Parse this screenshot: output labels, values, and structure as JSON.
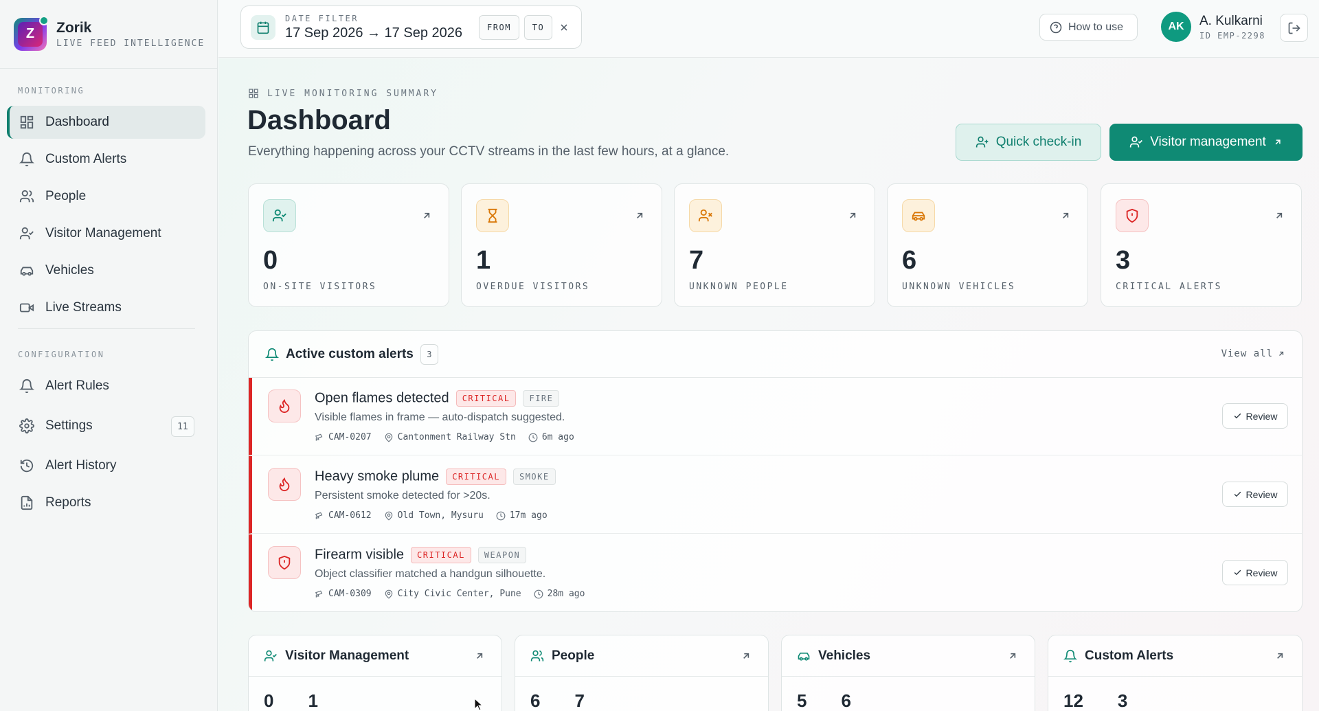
{
  "brand": {
    "name": "Zorik",
    "subtitle": "LIVE FEED INTELLIGENCE",
    "logo_letter": "Z"
  },
  "sidebar": {
    "sections": [
      {
        "label": "MONITORING"
      },
      {
        "label": "CONFIGURATION"
      }
    ],
    "items": [
      {
        "label": "Dashboard",
        "icon": "grid-icon",
        "active": true
      },
      {
        "label": "Custom Alerts",
        "icon": "bell-icon"
      },
      {
        "label": "People",
        "icon": "users-icon"
      },
      {
        "label": "Visitor Management",
        "icon": "user-check-icon"
      },
      {
        "label": "Vehicles",
        "icon": "car-icon"
      },
      {
        "label": "Live Streams",
        "icon": "video-icon"
      },
      {
        "label": "Alert Rules",
        "icon": "bell-icon"
      },
      {
        "label": "Settings",
        "icon": "gear-icon",
        "badge": "11"
      },
      {
        "label": "Alert History",
        "icon": "history-icon"
      },
      {
        "label": "Reports",
        "icon": "report-icon"
      }
    ]
  },
  "header": {
    "date_filter": {
      "label": "DATE FILTER",
      "value": "17 Sep 2026 → 17 Sep 2026",
      "from": "FROM",
      "to": "TO"
    },
    "how_to": "How to use",
    "user": {
      "initials": "AK",
      "name": "A. Kulkarni",
      "id": "ID EMP-2298"
    }
  },
  "page": {
    "kicker": "LIVE MONITORING SUMMARY",
    "title": "Dashboard",
    "subtitle": "Everything happening across your CCTV streams in the last few hours, at a glance.",
    "quick_checkin": "Quick check-in",
    "visitor_mgmt": "Visitor management"
  },
  "stats": [
    {
      "value": "0",
      "label": "ON-SITE VISITORS",
      "icon": "user-check-icon",
      "color": "#0f8a74",
      "bg": "#e0f2ee"
    },
    {
      "value": "1",
      "label": "OVERDUE VISITORS",
      "icon": "hourglass-icon",
      "color": "#d97706",
      "bg": "#fdf1dc"
    },
    {
      "value": "7",
      "label": "UNKNOWN PEOPLE",
      "icon": "user-x-icon",
      "color": "#d97706",
      "bg": "#fdf1dc"
    },
    {
      "value": "6",
      "label": "UNKNOWN VEHICLES",
      "icon": "car-icon",
      "color": "#d97706",
      "bg": "#fdf1dc"
    },
    {
      "value": "3",
      "label": "CRITICAL ALERTS",
      "icon": "shield-alert-icon",
      "color": "#dc2626",
      "bg": "#fde8e8"
    }
  ],
  "alerts": {
    "title": "Active custom alerts",
    "count": "3",
    "view_all": "View all",
    "review_label": "Review",
    "items": [
      {
        "title": "Open flames detected",
        "severity": "CRITICAL",
        "kind": "FIRE",
        "desc": "Visible flames in frame — auto-dispatch suggested.",
        "camera": "CAM-0207",
        "location": "Cantonment Railway Stn",
        "time": "6m ago",
        "icon": "flame-icon"
      },
      {
        "title": "Heavy smoke plume",
        "severity": "CRITICAL",
        "kind": "SMOKE",
        "desc": "Persistent smoke detected for >20s.",
        "camera": "CAM-0612",
        "location": "Old Town, Mysuru",
        "time": "17m ago",
        "icon": "flame-icon"
      },
      {
        "title": "Firearm visible",
        "severity": "CRITICAL",
        "kind": "WEAPON",
        "desc": "Object classifier matched a handgun silhouette.",
        "camera": "CAM-0309",
        "location": "City Civic Center, Pune",
        "time": "28m ago",
        "icon": "shield-alert-icon"
      }
    ]
  },
  "cards": [
    {
      "title": "Visitor Management",
      "icon": "user-check-icon",
      "nums": [
        "0",
        "1"
      ]
    },
    {
      "title": "People",
      "icon": "users-icon",
      "nums": [
        "6",
        "7"
      ]
    },
    {
      "title": "Vehicles",
      "icon": "car-icon",
      "nums": [
        "5",
        "6"
      ]
    },
    {
      "title": "Custom Alerts",
      "icon": "bell-icon",
      "nums": [
        "12",
        "3"
      ]
    }
  ]
}
